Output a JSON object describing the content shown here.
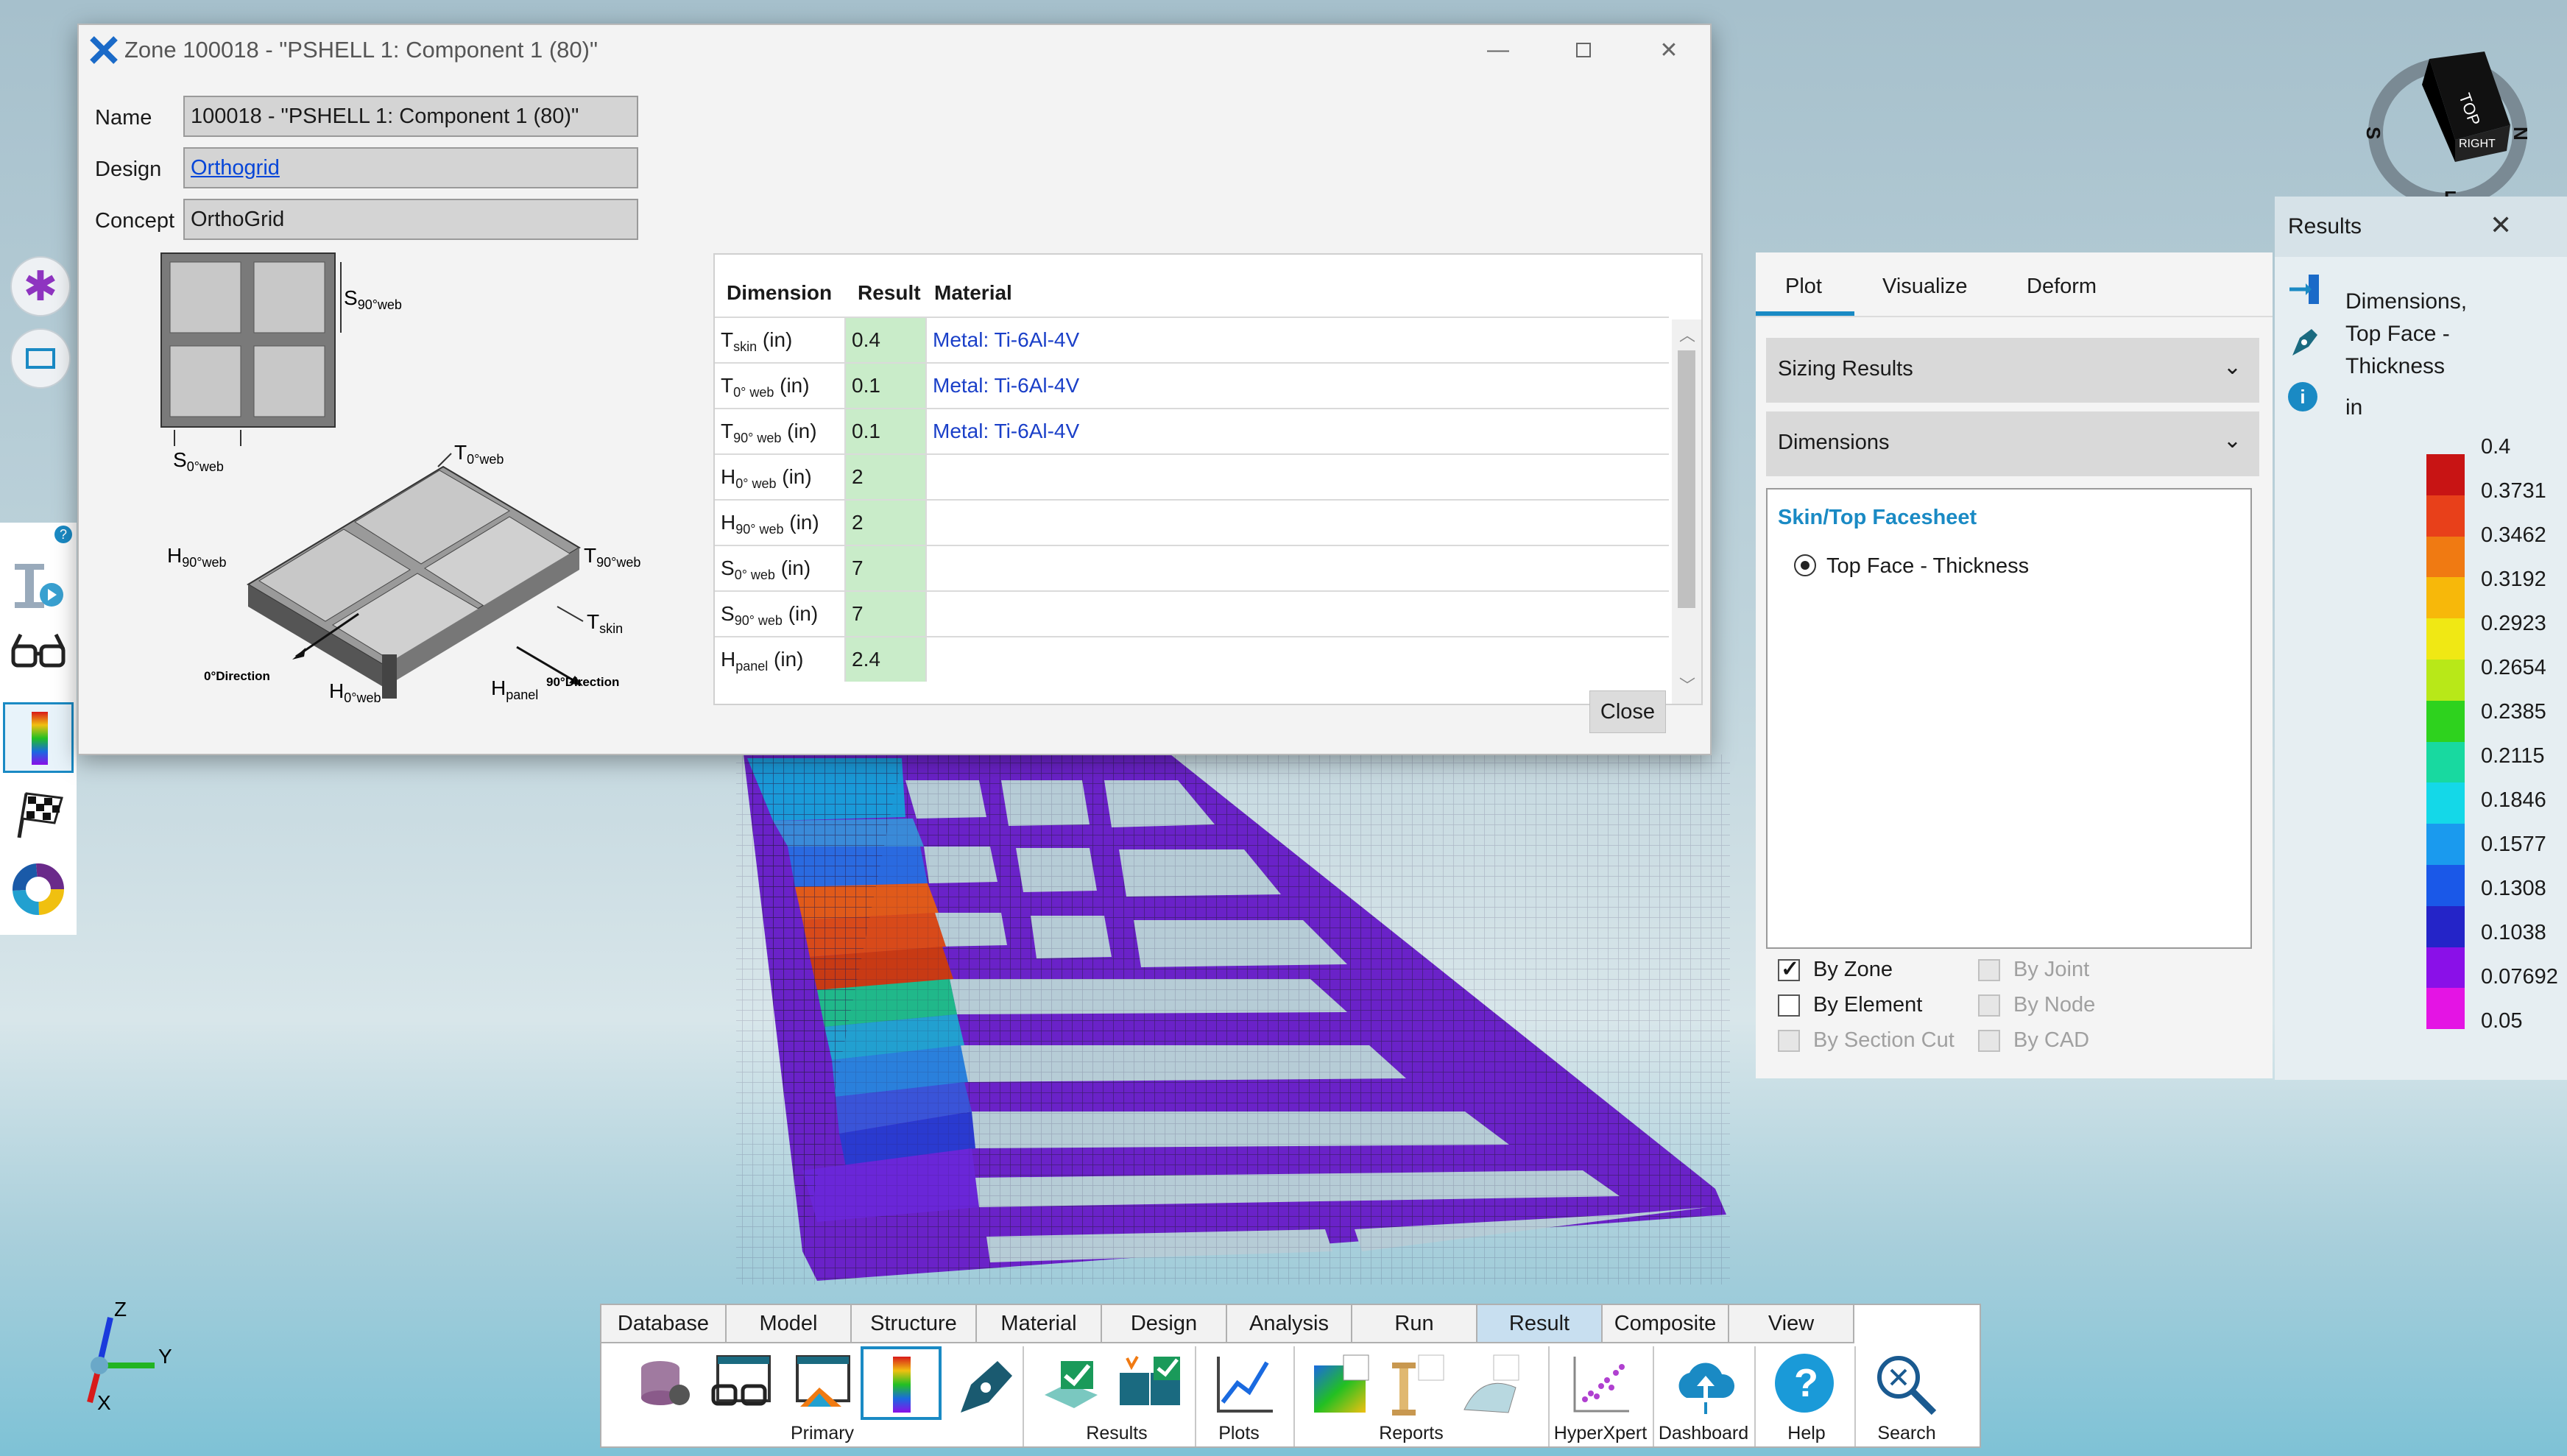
{
  "dialog": {
    "title": "Zone 100018 - \"PSHELL 1: Component 1 (80)\"",
    "fields": [
      {
        "label": "Name",
        "value": "100018 - \"PSHELL 1: Component 1 (80)\""
      },
      {
        "label": "Design",
        "value": "Orthogrid"
      },
      {
        "label": "Concept",
        "value": "OrthoGrid"
      }
    ],
    "diagram_labels": {
      "s90": "S",
      "s90_sub": "90°web",
      "s0": "S",
      "s0_sub": "0°web",
      "t0": "T",
      "t0_sub": "0°web",
      "h90": "H",
      "h90_sub": "90°web",
      "t90": "T",
      "t90_sub": "90°web",
      "tskin": "T",
      "tskin_sub": "skin",
      "h0": "H",
      "h0_sub": "0°web",
      "hpanel": "H",
      "hpanel_sub": "panel",
      "dir0": "0°Direction",
      "dir90": "90°Direction"
    },
    "table": {
      "headers": [
        "Dimension",
        "Result",
        "Material"
      ],
      "rows": [
        {
          "dim": "T",
          "sub": "skin",
          "unit": " (in)",
          "result": "0.4",
          "material": "Metal: Ti-6Al-4V"
        },
        {
          "dim": "T",
          "sub": "0° web",
          "unit": " (in)",
          "result": "0.1",
          "material": "Metal: Ti-6Al-4V"
        },
        {
          "dim": "T",
          "sub": "90° web",
          "unit": " (in)",
          "result": "0.1",
          "material": "Metal: Ti-6Al-4V"
        },
        {
          "dim": "H",
          "sub": "0° web",
          "unit": " (in)",
          "result": "2",
          "material": ""
        },
        {
          "dim": "H",
          "sub": "90° web",
          "unit": " (in)",
          "result": "2",
          "material": ""
        },
        {
          "dim": "S",
          "sub": "0° web",
          "unit": " (in)",
          "result": "7",
          "material": ""
        },
        {
          "dim": "S",
          "sub": "90° web",
          "unit": " (in)",
          "result": "7",
          "material": ""
        },
        {
          "dim": "H",
          "sub": "panel",
          "unit": " (in)",
          "result": "2.4",
          "material": ""
        }
      ]
    },
    "close_label": "Close"
  },
  "plot_panel": {
    "tabs": [
      "Plot",
      "Visualize",
      "Deform"
    ],
    "active_tab": "Plot",
    "sections": [
      "Sizing Results",
      "Dimensions"
    ],
    "group_title": "Skin/Top Facesheet",
    "option": "Top Face - Thickness",
    "checkboxes": [
      {
        "label": "By Zone",
        "checked": true,
        "enabled": true
      },
      {
        "label": "By Joint",
        "checked": false,
        "enabled": false
      },
      {
        "label": "By Element",
        "checked": false,
        "enabled": true
      },
      {
        "label": "By Node",
        "checked": false,
        "enabled": false
      },
      {
        "label": "By Section Cut",
        "checked": false,
        "enabled": false
      },
      {
        "label": "By CAD",
        "checked": false,
        "enabled": false
      }
    ]
  },
  "results_panel": {
    "title": "Results",
    "description": [
      "Dimensions,",
      "Top Face -",
      "Thickness"
    ],
    "unit": "in",
    "legend_values": [
      "0.4",
      "0.3731",
      "0.3462",
      "0.3192",
      "0.2923",
      "0.2654",
      "0.2385",
      "0.2115",
      "0.1846",
      "0.1577",
      "0.1308",
      "0.1038",
      "0.07692",
      "0.05"
    ],
    "legend_colors": [
      "#c81414",
      "#e8401a",
      "#f07a12",
      "#f7b80a",
      "#f0e814",
      "#b8e818",
      "#2ed21e",
      "#18d9a0",
      "#14d8e8",
      "#1a9aee",
      "#1a58e8",
      "#2424c8",
      "#8a10e8",
      "#e414e4"
    ]
  },
  "navcube": {
    "face_top": "TOP",
    "face_right": "RIGHT",
    "compass_s": "S",
    "compass_n": "N",
    "compass_e": "E"
  },
  "axes": {
    "x": "X",
    "y": "Y",
    "z": "Z"
  },
  "ribbon": {
    "tabs": [
      "Database",
      "Model",
      "Structure",
      "Material",
      "Design",
      "Analysis",
      "Run",
      "Result",
      "Composite",
      "View"
    ],
    "active_tab": "Result",
    "groups": [
      "Primary",
      "Results",
      "Plots",
      "Reports",
      "HyperXpert",
      "Dashboard",
      "Help",
      "Search"
    ]
  },
  "colors": {
    "accent": "#1a8ac4",
    "link": "#0645d8",
    "result_cell": "#c9ecc9"
  }
}
